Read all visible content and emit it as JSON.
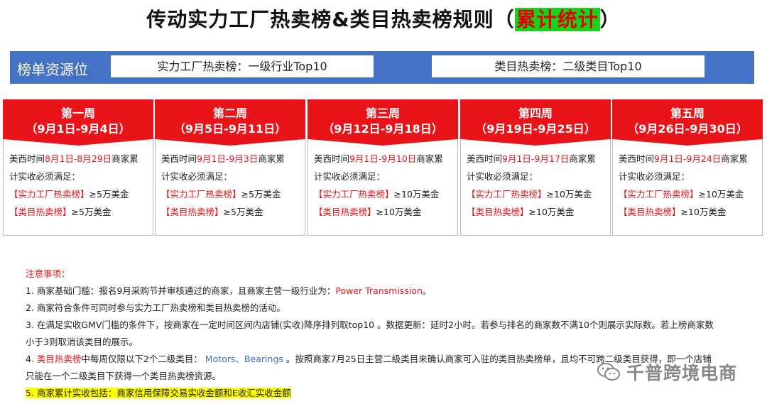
{
  "title": {
    "main": "传动实力工厂热卖榜&类目热卖榜规则（",
    "highlight": "累计统计",
    "end": "）"
  },
  "resource_bar": {
    "label": "榜单资源位",
    "box1": "实力工厂热卖榜：一级行业Top10",
    "box2": "类目热卖榜：二级类目Top10"
  },
  "weeks": [
    {
      "name": "第一周",
      "range": "（9月1日-9月4日）",
      "tz": "美西时间",
      "period": "8月1日-8月29日",
      "req_a": "商家累",
      "req_b": "计实收必须满足：",
      "factory_label": "【实力工厂热卖榜】",
      "factory_value": "≥5万美金",
      "cat_label": "【类目热卖榜】",
      "cat_value": "≥5万美金"
    },
    {
      "name": "第二周",
      "range": "（9月5日-9月11日）",
      "tz": "美西时间",
      "period": "9月1日-9月3日",
      "req_a": "商家累",
      "req_b": "计实收必须满足：",
      "factory_label": "【实力工厂热卖榜】",
      "factory_value": "≥5万美金",
      "cat_label": "【类目热卖榜】",
      "cat_value": "≥5万美金"
    },
    {
      "name": "第三周",
      "range": "（9月12日-9月18日）",
      "tz": "美西时间",
      "period": "9月1日-9月10日",
      "req_a": "商家累",
      "req_b": "计实收必须满足：",
      "factory_label": "【实力工厂热卖榜】",
      "factory_value": "≥10万美金",
      "cat_label": "【类目热卖榜】",
      "cat_value": "≥10万美金"
    },
    {
      "name": "第四周",
      "range": "（9月19日-9月25日）",
      "tz": "美西时间",
      "period": "9月1日-9月17日",
      "req_a": "商家累",
      "req_b": "计实收必须满足：",
      "factory_label": "【实力工厂热卖榜】",
      "factory_value": "≥10万美金",
      "cat_label": "【类目热卖榜】",
      "cat_value": "≥10万美金"
    },
    {
      "name": "第五周",
      "range": "（9月26日-9月30日）",
      "tz": "美西时间",
      "period": "9月1日-9月24日",
      "req_a": "商家累",
      "req_b": "计实收必须满足：",
      "factory_label": "【实力工厂热卖榜】",
      "factory_value": "≥10万美金",
      "cat_label": "【类目热卖榜】",
      "cat_value": "≥10万美金"
    }
  ],
  "notes": {
    "title": "注意事项：",
    "n1_a": "1. 商家基础门槛：报名9月采购节并审核通过的商家，且商家主营一级行业为：",
    "n1_b": "Power Transmission",
    "n1_c": "。",
    "n2": "2. 商家符合条件可同时参与实力工厂热卖榜和类目热卖榜的活动。",
    "n3_a": "3. 在满足实收GMV门槛的条件下，按商家在一定时间区间内店铺(实收)降序排列取top10 。数据更新：延时2小时。若参与排名的商家数不满10个则展示实际数。若上榜商家数",
    "n3_b": "小于3则取消该类目的展示。",
    "n4_a": "4. ",
    "n4_b": "类目热卖榜",
    "n4_c": "中每周仅限以下2个二级类目：",
    "n4_d": " Motors、Bearings ",
    "n4_e": "。按照商家7月25日主营二级类目来确认商家可入驻的类目热卖榜单，且均",
    "n4_f": "只能在一个二级类目下获得一个类目热卖榜资源。",
    "n4_tail": "不可跨二级类目获得，即一个店铺",
    "n5": "5. 商家累计实收包括：商家信用保障交易实收金额和E收汇实收金额"
  },
  "watermark": {
    "text": "千普跨境电商",
    "icon": "wechat-icon"
  }
}
